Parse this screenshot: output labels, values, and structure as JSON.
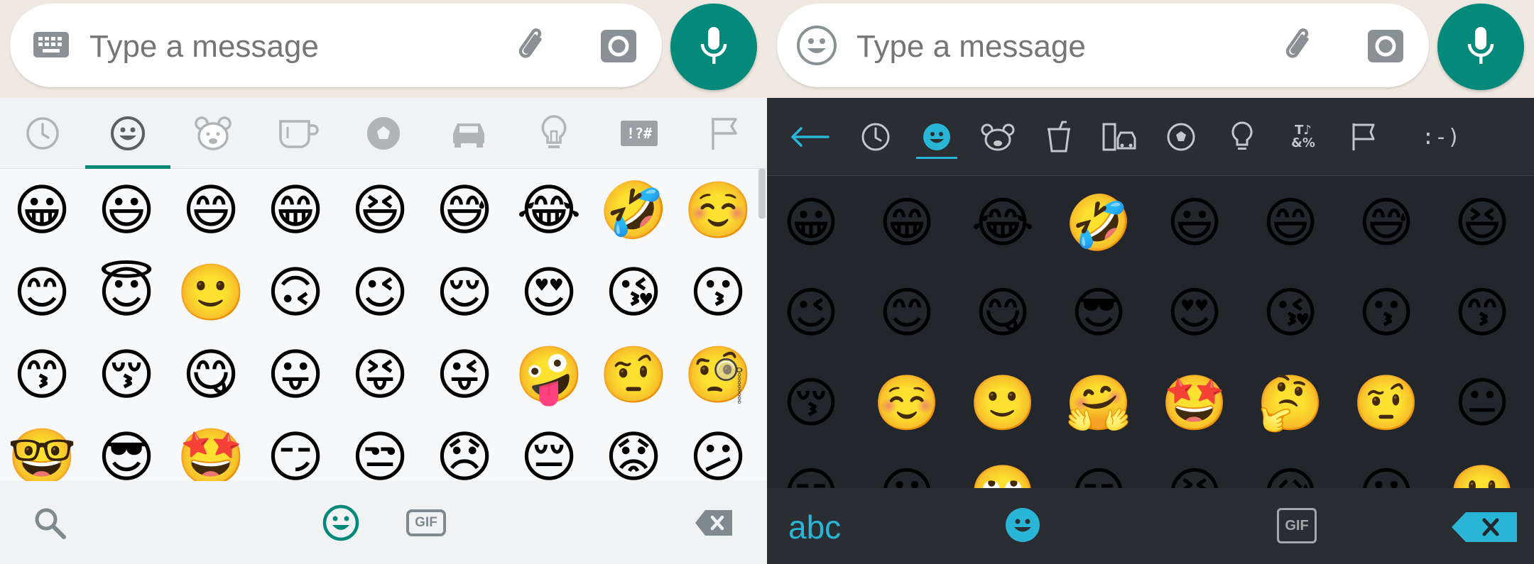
{
  "left": {
    "composer": {
      "placeholder": "Type a message",
      "mode_icon": "keyboard-icon"
    },
    "tabs": [
      "recent-clock-icon",
      "smileys-icon",
      "animals-bear-icon",
      "food-cup-icon",
      "activity-ball-icon",
      "travel-car-icon",
      "objects-bulb-icon",
      "symbols-icon",
      "flags-icon"
    ],
    "tab_symbols_label": "!?#",
    "active_tab_index": 1,
    "emojis": [
      [
        "😀",
        "😃",
        "😄",
        "😁",
        "😆",
        "😅",
        "😂",
        "🤣",
        "☺️"
      ],
      [
        "😊",
        "😇",
        "🙂",
        "🙃",
        "😉",
        "😌",
        "😍",
        "😘",
        "😗"
      ],
      [
        "😙",
        "😚",
        "😋",
        "😛",
        "😝",
        "😜",
        "🤪",
        "🤨",
        "🧐"
      ],
      [
        "🤓",
        "😎",
        "🤩",
        "😏",
        "😒",
        "😞",
        "😔",
        "😟",
        "😕"
      ]
    ],
    "bottom": {
      "gif_label": "GIF"
    },
    "accent": "#00897b"
  },
  "right": {
    "composer": {
      "placeholder": "Type a message",
      "mode_icon": "emoji-face-icon"
    },
    "tabs": [
      "back-arrow-icon",
      "recent-clock-icon",
      "smileys-icon",
      "animals-bear-icon",
      "food-cup-icon",
      "travel-buildings-icon",
      "activity-ball-icon",
      "objects-bulb-icon",
      "symbols-icon",
      "flags-icon",
      "emoticons-icon"
    ],
    "tab_emoticon_label": ":-)",
    "tab_symbols_label_top": "T♪",
    "tab_symbols_label_bottom": "&%",
    "active_tab_index": 2,
    "emojis": [
      [
        "😀",
        "😁",
        "😂",
        "🤣",
        "😃",
        "😄",
        "😅",
        "😆"
      ],
      [
        "😉",
        "😊",
        "😋",
        "😎",
        "😍",
        "😘",
        "😗",
        "😙"
      ],
      [
        "😚",
        "☺️",
        "🙂",
        "🤗",
        "🤩",
        "🤔",
        "🤨",
        "😐"
      ],
      [
        "😑",
        "😶",
        "🙄",
        "😏",
        "😣",
        "😥",
        "😮",
        "🤐"
      ]
    ],
    "bottom": {
      "abc_label": "abc",
      "gif_label": "GIF"
    },
    "accent": "#29b6d6"
  }
}
